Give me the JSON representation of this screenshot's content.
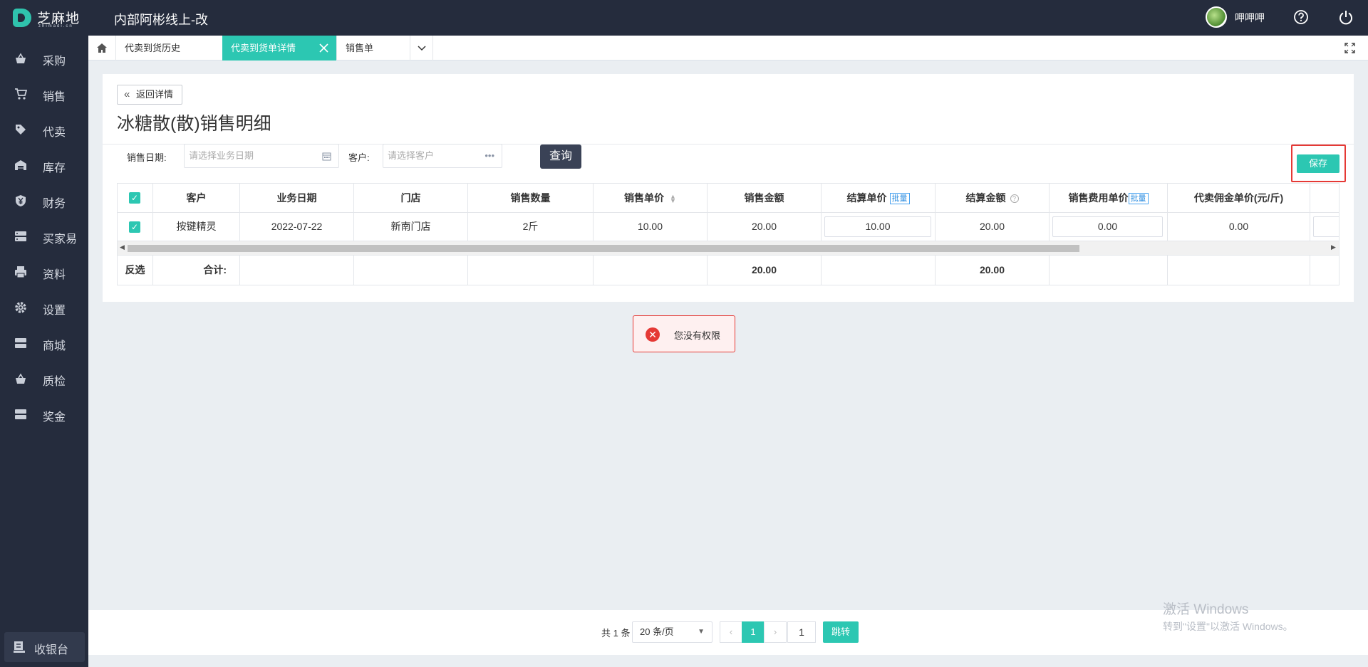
{
  "app": {
    "logo_text": "芝麻地",
    "logo_sub": "zhimadi.cn",
    "title": "内部阿彬线上-改",
    "username": "呷呷呷"
  },
  "sidebar": {
    "items": [
      {
        "label": "采购",
        "icon": "basket-icon"
      },
      {
        "label": "销售",
        "icon": "cart-icon"
      },
      {
        "label": "代卖",
        "icon": "tag-icon"
      },
      {
        "label": "库存",
        "icon": "warehouse-icon"
      },
      {
        "label": "财务",
        "icon": "yen-icon"
      },
      {
        "label": "买家易",
        "icon": "store-icon"
      },
      {
        "label": "资料",
        "icon": "printer-icon"
      },
      {
        "label": "设置",
        "icon": "gear-icon"
      },
      {
        "label": "商城",
        "icon": "shop-icon"
      },
      {
        "label": "质检",
        "icon": "basket-icon"
      },
      {
        "label": "奖金",
        "icon": "bonus-icon"
      }
    ],
    "cashier_label": "收银台"
  },
  "tabs": [
    {
      "label": "代卖到货历史",
      "active": false
    },
    {
      "label": "代卖到货单详情",
      "active": true
    },
    {
      "label": "销售单",
      "active": false
    }
  ],
  "page": {
    "back_label": "返回详情",
    "title": "冰糖散(散)销售明细"
  },
  "filters": {
    "date_label": "销售日期:",
    "date_placeholder": "请选择业务日期",
    "customer_label": "客户:",
    "customer_placeholder": "请选择客户",
    "query_label": "查询",
    "save_label": "保存"
  },
  "table": {
    "headers": {
      "customer": "客户",
      "date": "业务日期",
      "store": "门店",
      "qty": "销售数量",
      "unit_price": "销售单价",
      "amount": "销售金额",
      "settle_price": "结算单价",
      "settle_amount": "结算金额",
      "fee_price": "销售费用单价",
      "commission": "代卖佣金单价(元/斤)",
      "batch": "批量"
    },
    "rows": [
      {
        "customer": "按键精灵",
        "date": "2022-07-22",
        "store": "新南门店",
        "qty": "2斤",
        "unit_price": "10.00",
        "amount": "20.00",
        "settle_price": "10.00",
        "settle_amount": "20.00",
        "fee_price": "0.00",
        "commission": "0.00"
      }
    ],
    "footer": {
      "invert_label": "反选",
      "total_label": "合计:",
      "amount_total": "20.00",
      "settle_total": "20.00"
    }
  },
  "toast": {
    "message": "您没有权限"
  },
  "pagination": {
    "total_text": "共 1 条",
    "page_size": "20 条/页",
    "current_page": "1",
    "jump_value": "1",
    "jump_label": "跳转"
  },
  "watermark": {
    "line1": "激活 Windows",
    "line2": "转到\"设置\"以激活 Windows。"
  },
  "colors": {
    "accent": "#2cc7b2",
    "sidebar_bg": "#252c3d",
    "error": "#e53935"
  }
}
